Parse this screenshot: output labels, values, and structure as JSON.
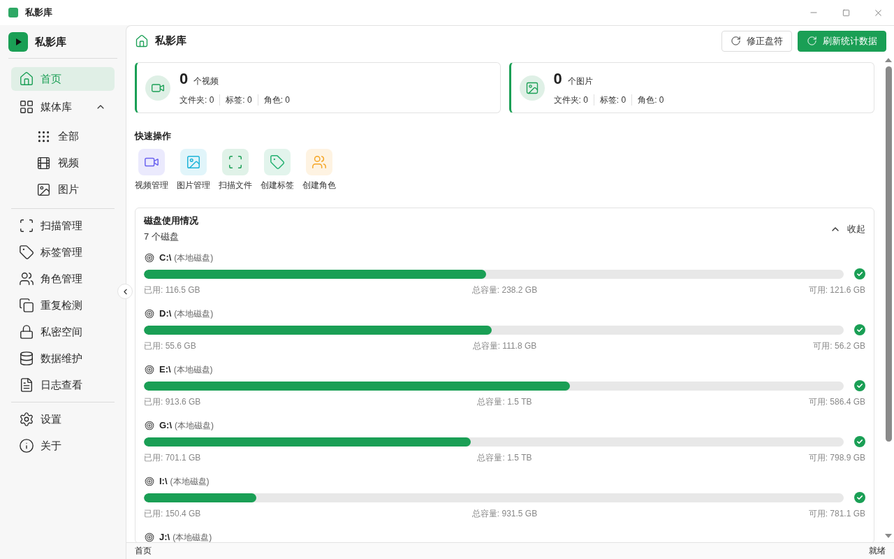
{
  "title_bar": {
    "title": "私影库"
  },
  "sidebar": {
    "brand": "私影库",
    "groups": [
      {
        "items": [
          {
            "label": "首页",
            "selected": true
          },
          {
            "label": "媒体库",
            "selected": false,
            "expanded": true,
            "children": [
              {
                "label": "全部",
                "selected": false
              },
              {
                "label": "视频",
                "selected": false
              },
              {
                "label": "图片",
                "selected": false
              }
            ]
          }
        ]
      },
      {
        "items": [
          {
            "label": "扫描管理",
            "selected": false
          },
          {
            "label": "标签管理",
            "selected": false
          },
          {
            "label": "角色管理",
            "selected": false
          },
          {
            "label": "重复检测",
            "selected": false
          },
          {
            "label": "私密空间",
            "selected": false
          },
          {
            "label": "数据维护",
            "selected": false
          },
          {
            "label": "日志查看",
            "selected": false
          }
        ]
      },
      {
        "items": [
          {
            "label": "设置",
            "selected": false
          },
          {
            "label": "关于",
            "selected": false
          }
        ]
      }
    ]
  },
  "header": {
    "title": "私影库",
    "buttons": [
      {
        "label": "修正盘符",
        "kind": "outline"
      },
      {
        "label": "刷新统计数据",
        "kind": "primary"
      }
    ]
  },
  "stat_cards": [
    {
      "count": "0",
      "unit": "个视频",
      "stats": [
        "文件夹: 0",
        "标签: 0",
        "角色: 0"
      ]
    },
    {
      "count": "0",
      "unit": "个图片",
      "stats": [
        "文件夹: 0",
        "标签: 0",
        "角色: 0"
      ]
    }
  ],
  "quick_actions": {
    "title": "快速操作",
    "items": [
      {
        "label": "视频管理",
        "color": "#6b63f0"
      },
      {
        "label": "图片管理",
        "color": "#1cb3d8"
      },
      {
        "label": "扫描文件",
        "color": "#1a9f55"
      },
      {
        "label": "创建标签",
        "color": "#22b070"
      },
      {
        "label": "创建角色",
        "color": "#f5a524"
      }
    ]
  },
  "disk_usage": {
    "title": "磁盘使用情况",
    "count": "7 个磁盘",
    "toggle": "收起",
    "expanded": true,
    "disks": [
      {
        "drive": "C:\\",
        "type": "(本地磁盘)",
        "level": 0.489,
        "used": "已用: 116.5 GB",
        "total": "总容量: 238.2 GB",
        "free": "可用: 121.6 GB"
      },
      {
        "drive": "D:\\",
        "type": "(本地磁盘)",
        "level": 0.497,
        "used": "已用: 55.6 GB",
        "total": "总容量: 111.8 GB",
        "free": "可用: 56.2 GB"
      },
      {
        "drive": "E:\\",
        "type": "(本地磁盘)",
        "level": 0.609,
        "used": "已用: 913.6 GB",
        "total": "总容量: 1.5 TB",
        "free": "可用: 586.4 GB"
      },
      {
        "drive": "G:\\",
        "type": "(本地磁盘)",
        "level": 0.467,
        "used": "已用: 701.1 GB",
        "total": "总容量: 1.5 TB",
        "free": "可用: 798.9 GB"
      },
      {
        "drive": "I:\\",
        "type": "(本地磁盘)",
        "level": 0.161,
        "used": "已用: 150.4 GB",
        "total": "总容量: 931.5 GB",
        "free": "可用: 781.1 GB"
      },
      {
        "drive": "J:\\",
        "type": "(本地磁盘)"
      }
    ]
  },
  "status_bar": {
    "left": "首页",
    "right": "就绪"
  }
}
